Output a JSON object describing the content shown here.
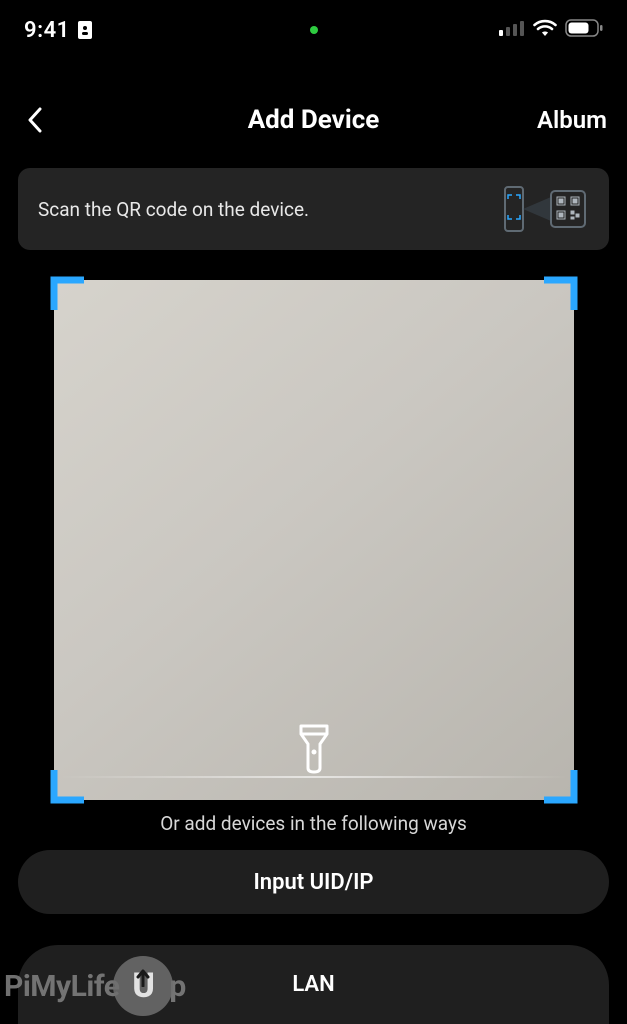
{
  "status": {
    "time": "9:41",
    "signal_bars": 1,
    "wifi": true,
    "battery_pct": 70
  },
  "nav": {
    "title": "Add Device",
    "album_label": "Album"
  },
  "banner": {
    "text": "Scan the QR code on the device."
  },
  "alt_text": "Or add devices in the following ways",
  "buttons": {
    "input_uid": "Input UID/IP",
    "lan": "LAN"
  },
  "watermark": {
    "part1": "PiMyLife",
    "part2": "p"
  },
  "colors": {
    "scan_corner": "#2aa7ff",
    "bg": "#000000",
    "panel": "#242424",
    "button": "#1f1f1f"
  },
  "icons": {
    "back": "chevron-left-icon",
    "torch": "flashlight-icon",
    "id": "id-card-icon",
    "wifi": "wifi-icon",
    "battery": "battery-icon",
    "cellular": "cellular-icon"
  }
}
